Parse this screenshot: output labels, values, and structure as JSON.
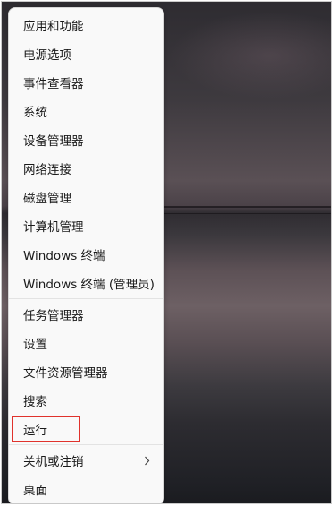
{
  "menu": {
    "items": [
      {
        "label": "应用和功能"
      },
      {
        "label": "电源选项"
      },
      {
        "label": "事件查看器"
      },
      {
        "label": "系统"
      },
      {
        "label": "设备管理器"
      },
      {
        "label": "网络连接"
      },
      {
        "label": "磁盘管理"
      },
      {
        "label": "计算机管理"
      },
      {
        "label": "Windows 终端"
      },
      {
        "label": "Windows 终端 (管理员)"
      },
      {
        "label": "任务管理器"
      },
      {
        "label": "设置"
      },
      {
        "label": "文件资源管理器"
      },
      {
        "label": "搜索"
      },
      {
        "label": "运行"
      },
      {
        "label": "关机或注销",
        "icon": "chevron-right-icon"
      },
      {
        "label": "桌面"
      }
    ]
  },
  "highlight": {
    "target": "运行",
    "color": "#e0322c"
  }
}
